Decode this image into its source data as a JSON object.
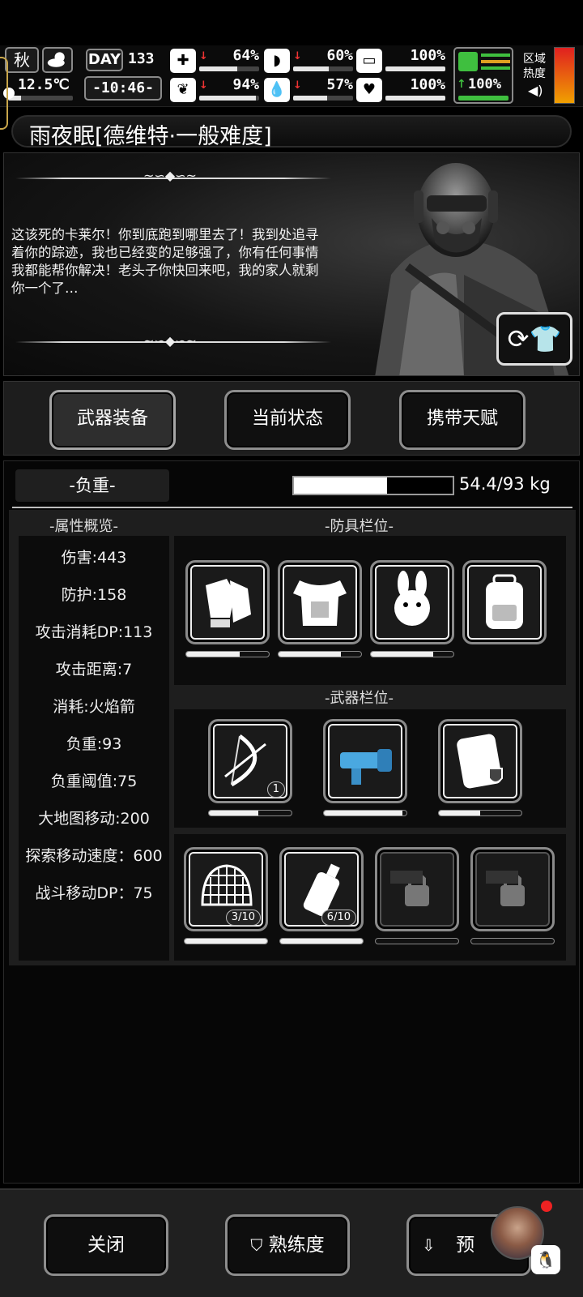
{
  "status": {
    "season": "秋",
    "temperature": "12.5℃",
    "day_label": "DAY",
    "day_value": "133",
    "clock": "-10:46-",
    "stats": [
      {
        "icon": "medkit-icon",
        "value": "64%",
        "trend": "down",
        "level": 0.64
      },
      {
        "icon": "stomach-icon",
        "value": "60%",
        "trend": "down",
        "level": 0.6
      },
      {
        "icon": "fuel-tank-icon",
        "value": "100%",
        "trend": "",
        "level": 1.0
      },
      {
        "icon": "brain-icon",
        "value": "94%",
        "trend": "down",
        "level": 0.94
      },
      {
        "icon": "water-drop-icon",
        "value": "57%",
        "trend": "down",
        "level": 0.57
      },
      {
        "icon": "heart-icon",
        "value": "100%",
        "trend": "",
        "level": 1.0
      }
    ],
    "stamina": "100%",
    "region_heat_label": "区域热度",
    "colors": {
      "stamina": "#3fbf3f",
      "heat_top": "#e02020",
      "heat_bottom": "#f0a000",
      "arrow_down": "#e33333",
      "arrow_up": "#3fbf3f"
    }
  },
  "title": "雨夜眠[德维特·一般难度]",
  "story": {
    "text": "这该死的卡莱尔！你到底跑到哪里去了！我到处追寻着你的踪迹，我也已经变的足够强了，你有任何事情我都能帮你解决！老头子你快回来吧，我的家人就剩你一个了…"
  },
  "tabs": [
    {
      "label": "武器装备",
      "active": true
    },
    {
      "label": "当前状态",
      "active": false
    },
    {
      "label": "携带天赋",
      "active": false
    }
  ],
  "load": {
    "label": "-负重-",
    "current": 54.4,
    "max": 93,
    "text": "54.4/93 kg"
  },
  "attributes": {
    "title": "-属性概览-",
    "items": [
      "伤害:443",
      "防护:158",
      "攻击消耗DP:113",
      "攻击距离:7",
      "消耗:火焰箭",
      "负重:93",
      "负重阈值:75",
      "大地图移动:200",
      "探索移动速度：600",
      "战斗移动DP：75"
    ]
  },
  "armor": {
    "title": "-防具栏位-",
    "slots": [
      {
        "name": "gloves-icon",
        "durability": 0.65
      },
      {
        "name": "body-armor-icon",
        "durability": 0.75
      },
      {
        "name": "bunny-helmet-icon",
        "durability": 0.75
      },
      {
        "name": "backpack-icon",
        "durability": null
      }
    ]
  },
  "weapons": {
    "title": "-武器栏位-",
    "slots": [
      {
        "name": "bow-icon",
        "durability": 0.6,
        "count": "1"
      },
      {
        "name": "minigun-icon",
        "durability": 0.95,
        "count": ""
      },
      {
        "name": "shield-device-icon",
        "durability": 0.5,
        "count": ""
      }
    ]
  },
  "consumables": {
    "slots": [
      {
        "name": "net-icon",
        "count": "3/10",
        "durability": 1.0,
        "locked": false
      },
      {
        "name": "bottle-icon",
        "count": "6/10",
        "durability": 1.0,
        "locked": false
      },
      {
        "name": "lock-icon",
        "count": "",
        "durability": 0,
        "locked": true
      },
      {
        "name": "lock-icon",
        "count": "",
        "durability": 0,
        "locked": true
      }
    ]
  },
  "bottom": {
    "close": "关闭",
    "proficiency": "熟练度",
    "preset": "预"
  }
}
